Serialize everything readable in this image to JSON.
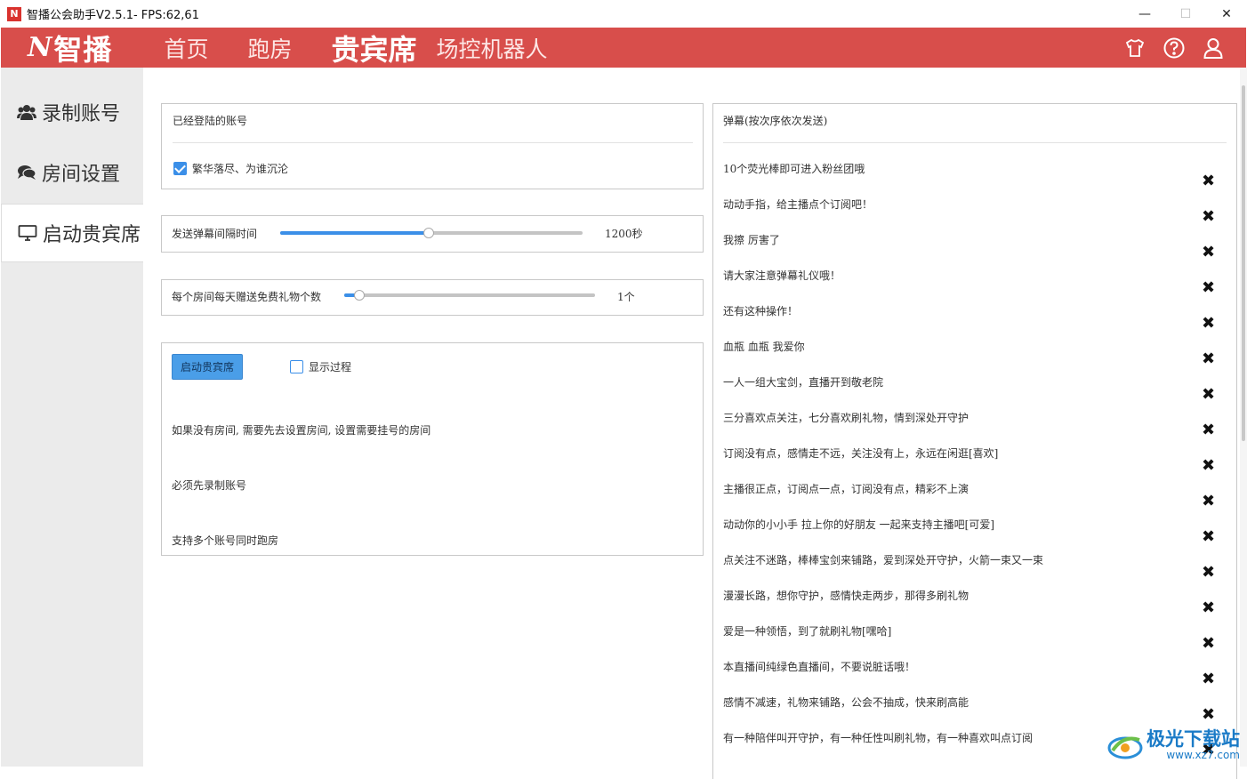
{
  "window": {
    "title": "智播公会助手V2.5.1- FPS:62,61",
    "app_icon_letter": "N",
    "min_label": "—",
    "max_label": "☐",
    "close_label": "✕"
  },
  "navbar": {
    "logo_mark": "N",
    "logo_text": "智播",
    "items": [
      {
        "label": "首页",
        "active": false
      },
      {
        "label": "跑房",
        "active": false
      },
      {
        "label": "贵宾席",
        "active": true
      },
      {
        "label": "场控机器人",
        "active": false
      }
    ],
    "icons": [
      "shirt-icon",
      "help-icon",
      "user-icon"
    ],
    "bg_color": "#d84e4b"
  },
  "sidebar": {
    "items": [
      {
        "label": "录制账号",
        "icon": "users-icon",
        "active": false
      },
      {
        "label": "房间设置",
        "icon": "chat-icon",
        "active": false
      },
      {
        "label": "启动贵宾席",
        "icon": "monitor-icon",
        "active": true
      }
    ]
  },
  "accounts": {
    "title": "已经登陆的账号",
    "items": [
      {
        "label": "繁华落尽、为谁沉沦",
        "checked": true
      }
    ]
  },
  "interval": {
    "label": "发送弹幕间隔时间",
    "value": "1200秒",
    "fill_fraction": 0.49
  },
  "gifts": {
    "label": "每个房间每天赠送免费礼物个数",
    "value": "1个",
    "fill_fraction": 0.06
  },
  "start": {
    "button_label": "启动贵宾席",
    "show_process_label": "显示过程",
    "show_process_checked": false,
    "notes": [
      "如果没有房间, 需要先去设置房间, 设置需要挂号的房间",
      "必须先录制账号",
      "支持多个账号同时跑房"
    ]
  },
  "danmu": {
    "title": "弹幕(按次序依次发送)",
    "delete_icon": "✖",
    "items": [
      "10个荧光棒即可进入粉丝团哦",
      "动动手指，给主播点个订阅吧！",
      "我擦  厉害了",
      "请大家注意弹幕礼仪哦！",
      "还有这种操作！",
      "血瓶  血瓶  我爱你",
      "一人一组大宝剑，直播开到敬老院",
      "三分喜欢点关注，七分喜欢刷礼物，情到深处开守护",
      "订阅没有点，感情走不远，关注没有上，永远在闲逛[喜欢]",
      "主播很正点，订阅点一点，订阅没有点，精彩不上演",
      "动动你的小小手  拉上你的好朋友  一起来支持主播吧[可爱]",
      "点关注不迷路，棒棒宝剑来铺路，爱到深处开守护，火箭一束又一束",
      "漫漫长路，想你守护，感情快走两步，那得多刷礼物",
      "爱是一种领悟，到了就刷礼物[嘿哈]",
      "本直播间纯绿色直播间，不要说脏话哦！",
      "感情不减速，礼物来铺路，公会不抽成，快来刷高能",
      "有一种陪伴叫开守护，有一种任性叫刷礼物，有一种喜欢叫点订阅"
    ]
  },
  "watermark": {
    "title": "极光下载站",
    "url": "www.xz7.com"
  }
}
